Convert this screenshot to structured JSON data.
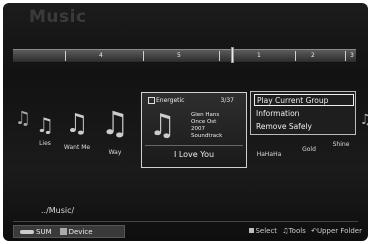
{
  "screen_title": "Music",
  "timeline": {
    "labels": [
      "4",
      "5",
      "1",
      "2",
      "3"
    ]
  },
  "albums": [
    {
      "label": ""
    },
    {
      "label": "Lies"
    },
    {
      "label": "Want Me"
    },
    {
      "label": "Way"
    },
    {
      "label": "HaHaHa"
    },
    {
      "label": "Gold"
    },
    {
      "label": "Shine"
    }
  ],
  "info_card": {
    "mood": "Energetic",
    "count": "3/37",
    "artist": "Glen Hans",
    "album": "Once Ost",
    "year": "2007",
    "genre": "Soundtrack",
    "title": "I Love You"
  },
  "menu": {
    "items": [
      "Play Current Group",
      "Information",
      "Remove Safely"
    ]
  },
  "path": "../Music/",
  "footer": {
    "sum_label": "SUM",
    "device_label": "Device",
    "select_label": "Select",
    "tools_label": "Tools",
    "upper_label": "Upper Folder"
  },
  "icons": {
    "album": "music-note-icon",
    "tools": "tools-icon",
    "return": "return-icon"
  }
}
